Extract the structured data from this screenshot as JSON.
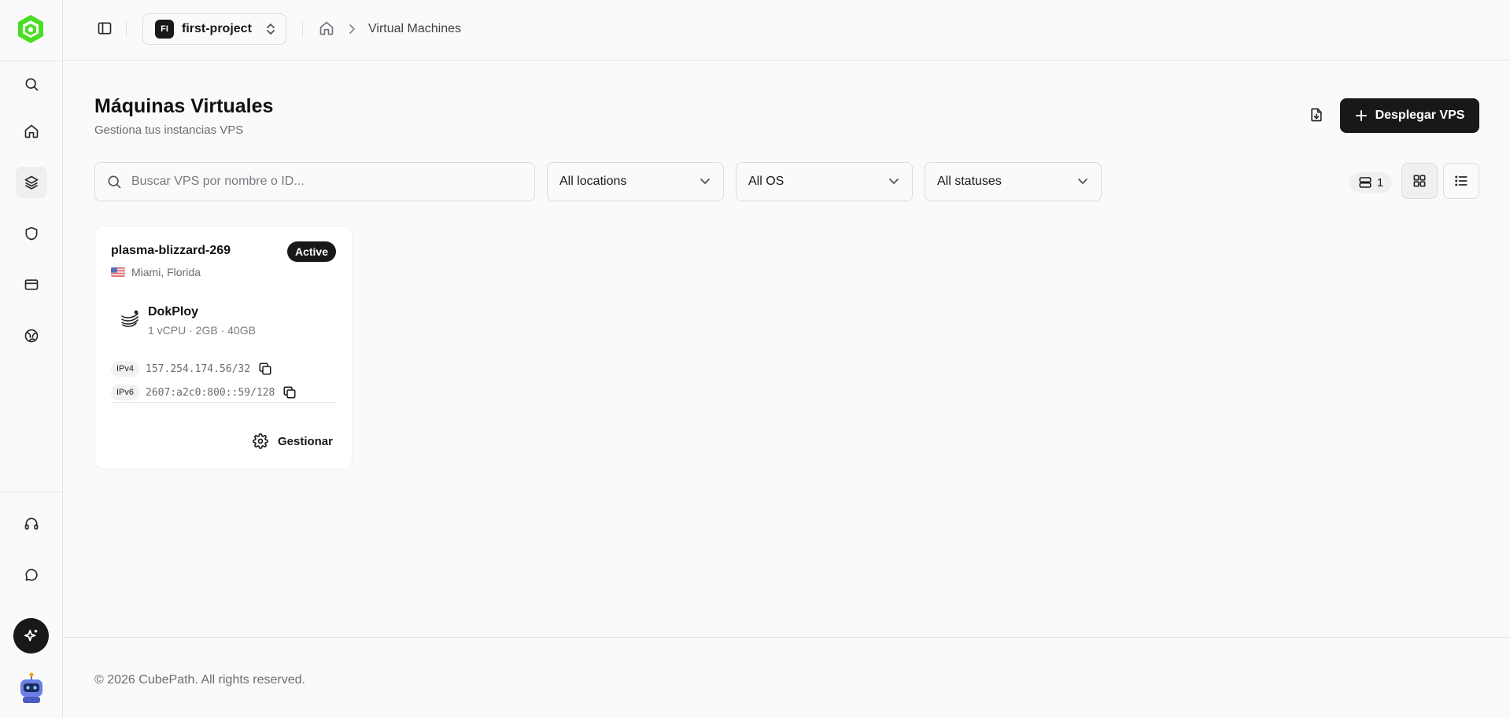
{
  "app": {
    "brand_color": "#4ade23"
  },
  "topbar": {
    "project_initials": "FI",
    "project_name": "first-project",
    "breadcrumb_current": "Virtual Machines"
  },
  "sidebar": {
    "items": [
      {
        "icon": "search-icon"
      },
      {
        "icon": "home-icon"
      },
      {
        "icon": "layers-icon",
        "active": true
      },
      {
        "icon": "shield-icon"
      },
      {
        "icon": "credit-card-icon"
      },
      {
        "icon": "globe-icon"
      },
      {
        "icon": "headset-icon"
      },
      {
        "icon": "chat-icon"
      },
      {
        "icon": "sparkles-icon"
      }
    ]
  },
  "header": {
    "title": "Máquinas Virtuales",
    "subtitle": "Gestiona tus instancias VPS",
    "deploy_label": "Desplegar VPS"
  },
  "filters": {
    "search_placeholder": "Buscar VPS por nombre o ID...",
    "location": "All locations",
    "os": "All OS",
    "status": "All statuses",
    "count": "1"
  },
  "vms": [
    {
      "name": "plasma-blizzard-269",
      "status": "Active",
      "location": "Miami, Florida",
      "os_name": "DokPloy",
      "specs": "1 vCPU · 2GB · 40GB",
      "ipv4_label": "IPv4",
      "ipv4": "157.254.174.56/32",
      "ipv6_label": "IPv6",
      "ipv6": "2607:a2c0:800::59/128",
      "manage_label": "Gestionar"
    }
  ],
  "footer": {
    "copyright": "© 2026 CubePath. All rights reserved."
  }
}
